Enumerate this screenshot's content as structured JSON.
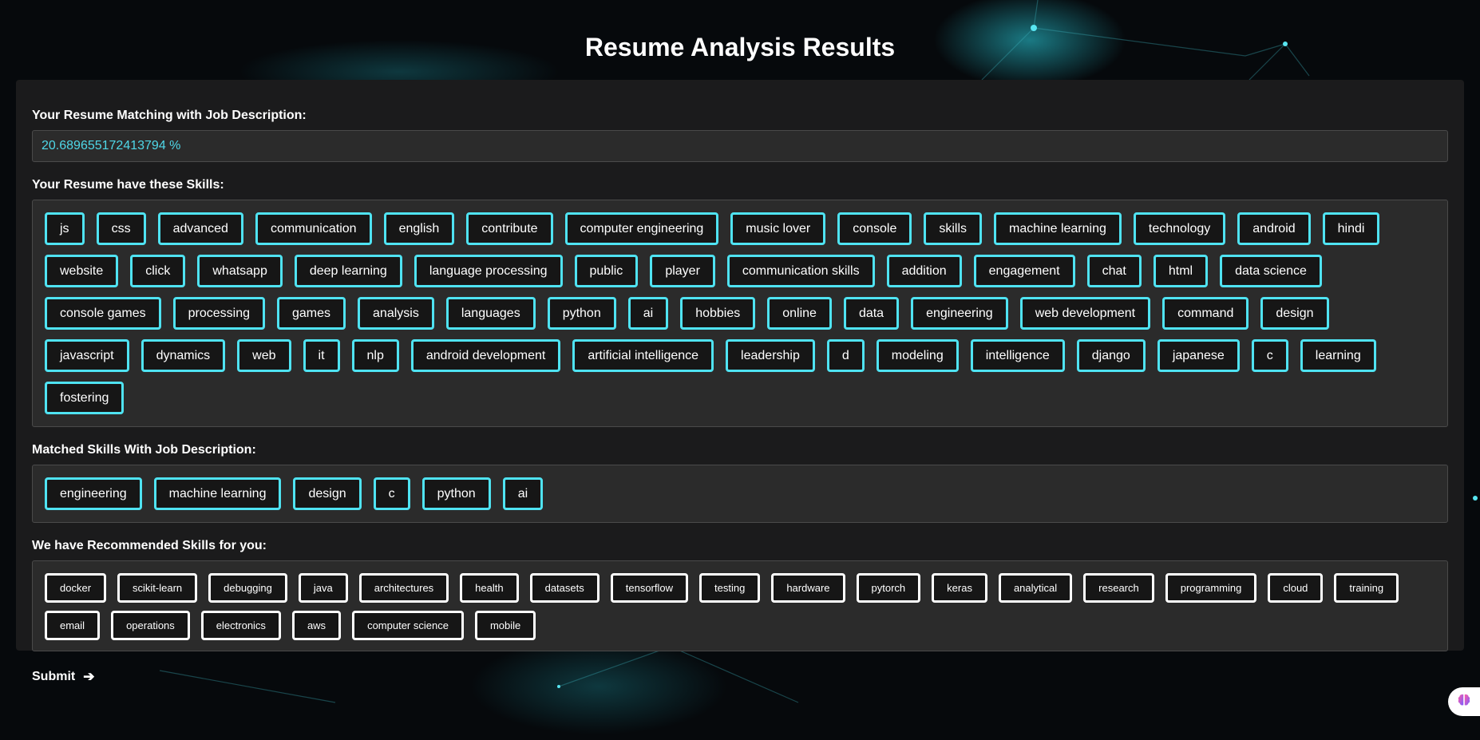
{
  "page": {
    "title": "Resume Analysis Results"
  },
  "match": {
    "label": "Your Resume Matching with Job Description:",
    "value": "20.689655172413794 %"
  },
  "resume_skills": {
    "label": "Your Resume have these Skills:",
    "items": [
      "js",
      "css",
      "advanced",
      "communication",
      "english",
      "contribute",
      "computer engineering",
      "music lover",
      "console",
      "skills",
      "machine learning",
      "technology",
      "android",
      "hindi",
      "website",
      "click",
      "whatsapp",
      "deep learning",
      "language processing",
      "public",
      "player",
      "communication skills",
      "addition",
      "engagement",
      "chat",
      "html",
      "data science",
      "console games",
      "processing",
      "games",
      "analysis",
      "languages",
      "python",
      "ai",
      "hobbies",
      "online",
      "data",
      "engineering",
      "web development",
      "command",
      "design",
      "javascript",
      "dynamics",
      "web",
      "it",
      "nlp",
      "android development",
      "artificial intelligence",
      "leadership",
      "d",
      "modeling",
      "intelligence",
      "django",
      "japanese",
      "c",
      "learning",
      "fostering"
    ]
  },
  "matched_skills": {
    "label": "Matched Skills With Job Description:",
    "items": [
      "engineering",
      "machine learning",
      "design",
      "c",
      "python",
      "ai"
    ]
  },
  "recommended_skills": {
    "label": "We have Recommended Skills for you:",
    "items": [
      "docker",
      "scikit-learn",
      "debugging",
      "java",
      "architectures",
      "health",
      "datasets",
      "tensorflow",
      "testing",
      "hardware",
      "pytorch",
      "keras",
      "analytical",
      "research",
      "programming",
      "cloud",
      "training",
      "email",
      "operations",
      "electronics",
      "aws",
      "computer science",
      "mobile"
    ]
  },
  "submit": {
    "label": "Submit",
    "arrow": "➔"
  },
  "icons": {
    "floating_button": "brain-icon"
  },
  "colors": {
    "accent": "#4fe3f2",
    "panel": "#1b1b1c",
    "box": "#2b2b2b",
    "background": "#06090c"
  }
}
